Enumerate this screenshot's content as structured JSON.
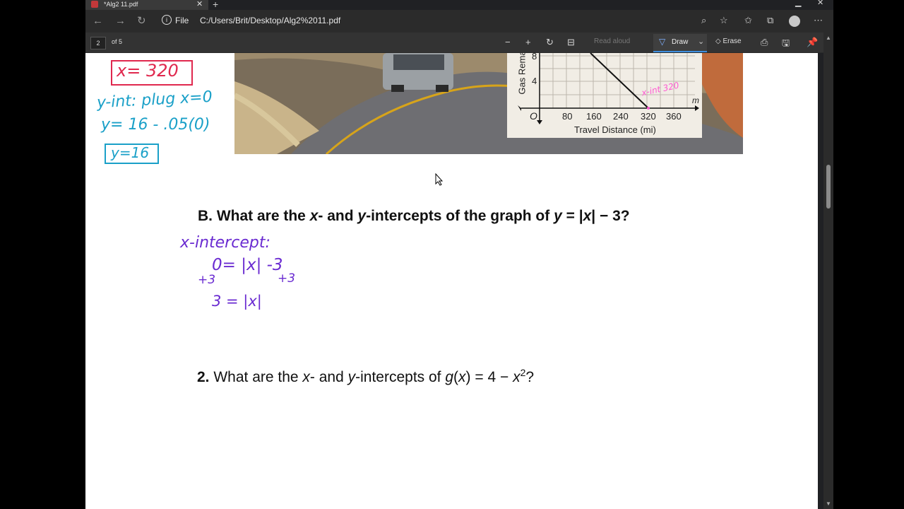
{
  "browser": {
    "tab_title": "*Alg2 11.pdf",
    "tab_close": "✕",
    "new_tab": "+",
    "address_scheme": "File",
    "address_url": "C:/Users/Brit/Desktop/Alg2%2011.pdf"
  },
  "pdf_toolbar": {
    "page_number": "2",
    "page_total": "of 5",
    "read_aloud": "Read aloud",
    "draw": "Draw",
    "erase": "Erase"
  },
  "figure": {
    "y_axis_label": "Gas Rema",
    "x_axis_label": "Travel Distance (mi)",
    "y_ticks": [
      "8",
      "4"
    ],
    "origin": "O",
    "x_ticks": [
      "80",
      "160",
      "240",
      "320",
      "360"
    ],
    "x_var": "m"
  },
  "handwriting": {
    "red_eq": "x= 320",
    "teal_line1": "y-int: plug x=0",
    "teal_line2": "y= 16 - .05(0)",
    "teal_answer": "y=16",
    "pink_note": "x-int 320",
    "purple_heading": "x-intercept:",
    "purple_line1": "0= |x| -3",
    "purple_add_left": "+3",
    "purple_add_right": "+3",
    "purple_line2": "3 = |x|",
    "colors": {
      "red": "#e0284e",
      "teal": "#1aa0c8",
      "pink": "#ff5ad2",
      "purple": "#6a2bd1"
    }
  },
  "questions": {
    "b_prefix": "B. What are the ",
    "b_x": "x",
    "b_mid": "- and ",
    "b_y": "y",
    "b_after": "-intercepts of the graph of ",
    "b_eq_y": "y",
    "b_eq_rest": " = |",
    "b_eq_x": "x",
    "b_eq_end": "| − 3?",
    "q2_num": "2.",
    "q2_prefix": " What are the ",
    "q2_x": "x",
    "q2_mid": "- and ",
    "q2_y": "y",
    "q2_after": "-intercepts of ",
    "q2_g": "g",
    "q2_paren": "(",
    "q2_xx": "x",
    "q2_eq": ") = 4 − ",
    "q2_x2": "x",
    "q2_exp": "2",
    "q2_q": "?"
  }
}
